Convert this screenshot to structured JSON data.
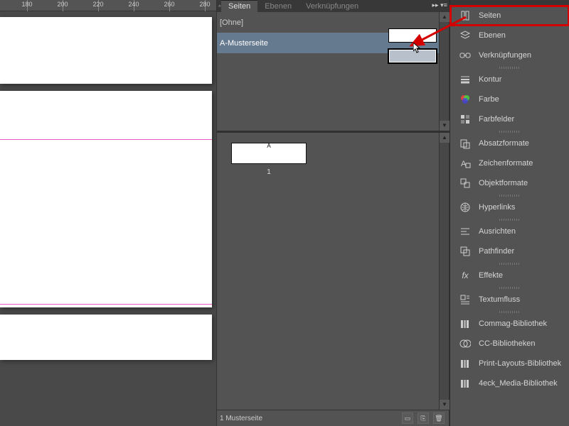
{
  "ruler": {
    "marks": [
      "180",
      "200",
      "220",
      "240",
      "260",
      "280"
    ]
  },
  "panel": {
    "tabs": {
      "pages": "Seiten",
      "layers": "Ebenen",
      "links": "Verknüpfungen"
    },
    "masters": {
      "none": "[Ohne]",
      "a": "A-Musterseite"
    },
    "doc": {
      "label": "A",
      "num": "1"
    },
    "footer": "1 Musterseite"
  },
  "sidebar": {
    "items": [
      {
        "id": "pages",
        "label": "Seiten"
      },
      {
        "id": "layers",
        "label": "Ebenen"
      },
      {
        "id": "links",
        "label": "Verknüpfungen"
      },
      {
        "id": "stroke",
        "label": "Kontur"
      },
      {
        "id": "color",
        "label": "Farbe"
      },
      {
        "id": "swatches",
        "label": "Farbfelder"
      },
      {
        "id": "parastyles",
        "label": "Absatzformate"
      },
      {
        "id": "charstyles",
        "label": "Zeichenformate"
      },
      {
        "id": "objstyles",
        "label": "Objektformate"
      },
      {
        "id": "hyperlinks",
        "label": "Hyperlinks"
      },
      {
        "id": "align",
        "label": "Ausrichten"
      },
      {
        "id": "pathfinder",
        "label": "Pathfinder"
      },
      {
        "id": "effects",
        "label": "Effekte"
      },
      {
        "id": "textwrap",
        "label": "Textumfluss"
      },
      {
        "id": "lib1",
        "label": "Commag-Bibliothek"
      },
      {
        "id": "cclib",
        "label": "CC-Bibliotheken"
      },
      {
        "id": "lib2",
        "label": "Print-Layouts-Bibliothek"
      },
      {
        "id": "lib3",
        "label": "4eck_Media-Bibliothek"
      }
    ]
  }
}
